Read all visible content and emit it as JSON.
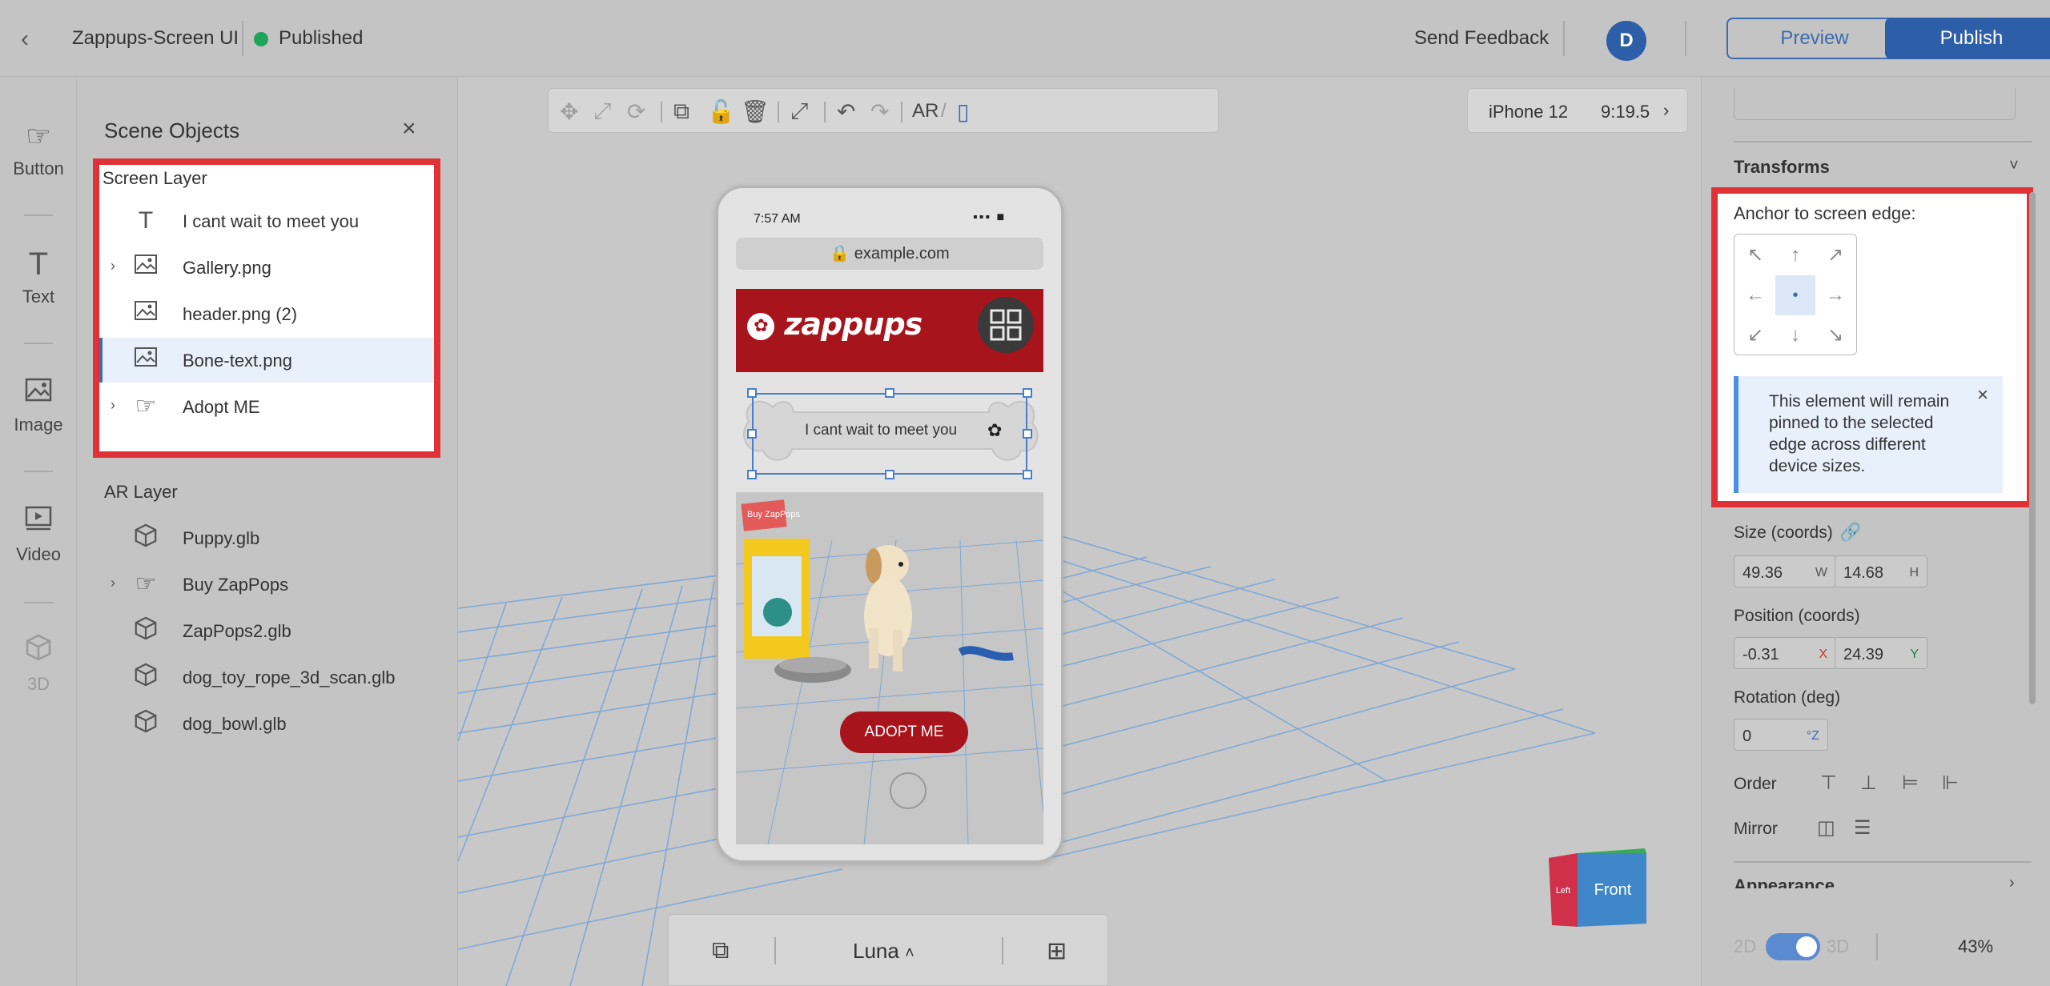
{
  "topbar": {
    "project_title": "Zappups-Screen UI",
    "status": "Published",
    "feedback": "Send Feedback",
    "avatar_initial": "D",
    "preview": "Preview",
    "publish": "Publish"
  },
  "rail": {
    "items": [
      {
        "label": "Button",
        "icon": "hand-pointer-icon"
      },
      {
        "label": "Text",
        "icon": "text-icon"
      },
      {
        "label": "Image",
        "icon": "image-icon"
      },
      {
        "label": "Video",
        "icon": "video-icon"
      },
      {
        "label": "3D",
        "icon": "cube-icon"
      }
    ]
  },
  "scene_objects": {
    "title": "Scene Objects",
    "screen_layer": {
      "title": "Screen Layer",
      "items": [
        {
          "label": "I cant wait to meet you",
          "icon": "text-icon"
        },
        {
          "label": "Gallery.png",
          "icon": "image-icon"
        },
        {
          "label": "header.png (2)",
          "icon": "image-icon"
        },
        {
          "label": "Bone-text.png",
          "icon": "image-icon"
        },
        {
          "label": "Adopt ME",
          "icon": "hand-pointer-icon"
        }
      ]
    },
    "ar_layer": {
      "title": "AR Layer",
      "items": [
        {
          "label": "Puppy.glb",
          "icon": "cube-icon"
        },
        {
          "label": "Buy ZapPops",
          "icon": "hand-pointer-icon"
        },
        {
          "label": "ZapPops2.glb",
          "icon": "cube-icon"
        },
        {
          "label": "dog_toy_rope_3d_scan.glb",
          "icon": "cube-icon"
        },
        {
          "label": "dog_bowl.glb",
          "icon": "cube-icon"
        }
      ]
    }
  },
  "canvas": {
    "mode": "AR",
    "mode_sep": "/",
    "device": "iPhone 12",
    "ratio": "9:19.5",
    "phone": {
      "time": "7:57 AM",
      "url": "example.com",
      "logo": "zappups",
      "bone_text": "I cant wait to meet you",
      "adopt_button": "ADOPT ME",
      "box_label": "Buy ZapPops"
    },
    "cube_label": "Front",
    "cube_side": "Left",
    "environment": "Luna"
  },
  "properties": {
    "section": "Transforms",
    "anchor_label": "Anchor to screen edge:",
    "info": "This element will remain pinned to the selected edge across different device sizes.",
    "size_label": "Size (coords)",
    "size_w": "49.36",
    "size_h": "14.68",
    "position_label": "Position (coords)",
    "pos_x": "-0.31",
    "pos_y": "24.39",
    "rotation_label": "Rotation (deg)",
    "rot_z": "0",
    "order_label": "Order",
    "mirror_label": "Mirror",
    "appearance_label": "Appearance",
    "toggle_2d": "2D",
    "toggle_3d": "3D",
    "zoom": "43%",
    "unit_w": "W",
    "unit_h": "H",
    "unit_x": "X",
    "unit_y": "Y",
    "unit_z": "°Z"
  }
}
